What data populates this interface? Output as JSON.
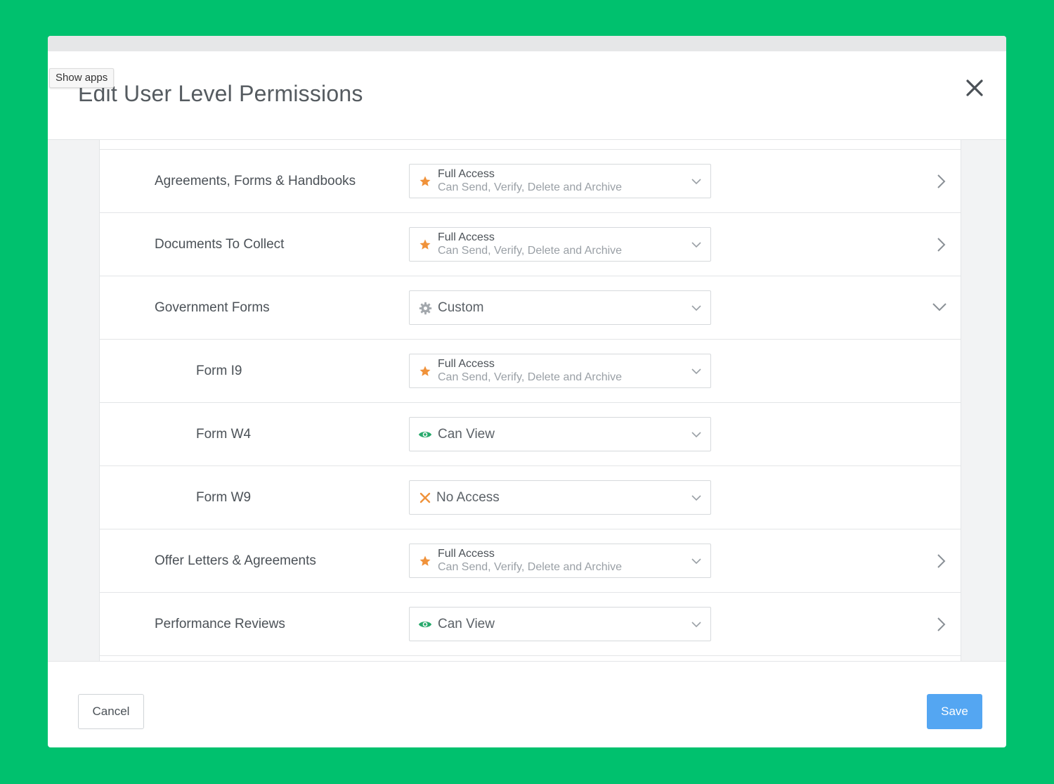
{
  "show_apps_label": "Show apps",
  "modal": {
    "title": "Edit User Level Permissions",
    "cancel_label": "Cancel",
    "save_label": "Save"
  },
  "colors": {
    "background": "#00c16e",
    "accent_blue": "#54a6f2",
    "star_orange": "#f0923a",
    "eye_green": "#27a96c",
    "gear_gray": "#a3a8ad"
  },
  "rows": [
    {
      "label": "Agreements, Forms & Handbooks",
      "level": "child-no",
      "access_title": "Full Access",
      "access_desc": "Can Send, Verify, Delete and Archive",
      "icon": "star-icon",
      "chevron": "chevron-right-icon"
    },
    {
      "label": "Documents To Collect",
      "access_title": "Full Access",
      "access_desc": "Can Send, Verify, Delete and Archive",
      "icon": "star-icon",
      "chevron": "chevron-right-icon"
    },
    {
      "label": "Government Forms",
      "access_title": "Custom",
      "icon": "gear-icon",
      "chevron": "chevron-down-icon"
    },
    {
      "label": "Form I9",
      "access_title": "Full Access",
      "access_desc": "Can Send, Verify, Delete and Archive",
      "icon": "star-icon"
    },
    {
      "label": "Form W4",
      "access_title": "Can View",
      "icon": "eye-icon"
    },
    {
      "label": "Form W9",
      "access_title": "No Access",
      "icon": "x-icon"
    },
    {
      "label": "Offer Letters & Agreements",
      "access_title": "Full Access",
      "access_desc": "Can Send, Verify, Delete and Archive",
      "icon": "star-icon",
      "chevron": "chevron-right-icon"
    },
    {
      "label": "Performance Reviews",
      "access_title": "Can View",
      "icon": "eye-icon",
      "chevron": "chevron-right-icon"
    }
  ]
}
